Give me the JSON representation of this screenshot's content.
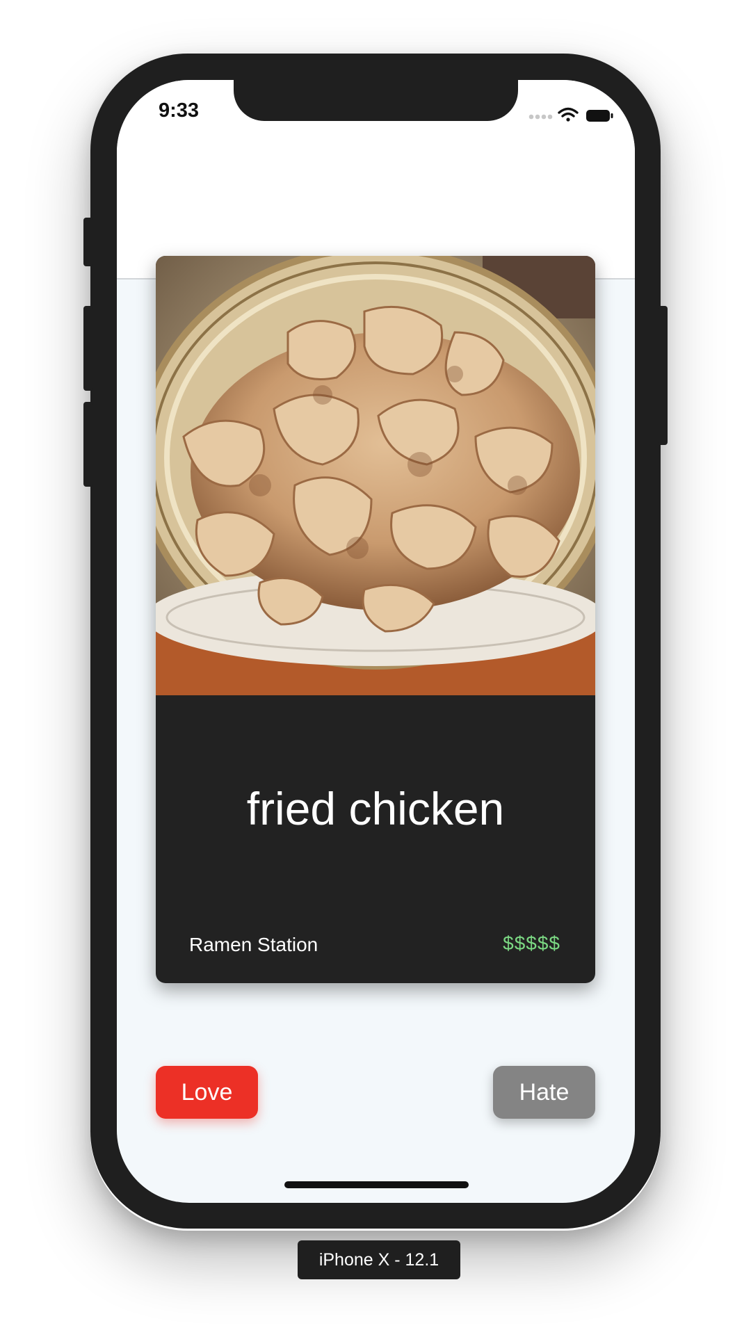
{
  "status_bar": {
    "time": "9:33",
    "icons": [
      "signal-dots-icon",
      "wifi-icon",
      "battery-icon"
    ]
  },
  "card": {
    "image_alt": "fried chicken in a woven basket",
    "dish_name": "fried chicken",
    "restaurant": "Ramen Station",
    "price": "$$$$$",
    "price_color": "#7bd883"
  },
  "actions": {
    "love_label": "Love",
    "hate_label": "Hate",
    "love_color": "#ec3026",
    "hate_color": "#848484"
  },
  "device_label": "iPhone X - 12.1"
}
